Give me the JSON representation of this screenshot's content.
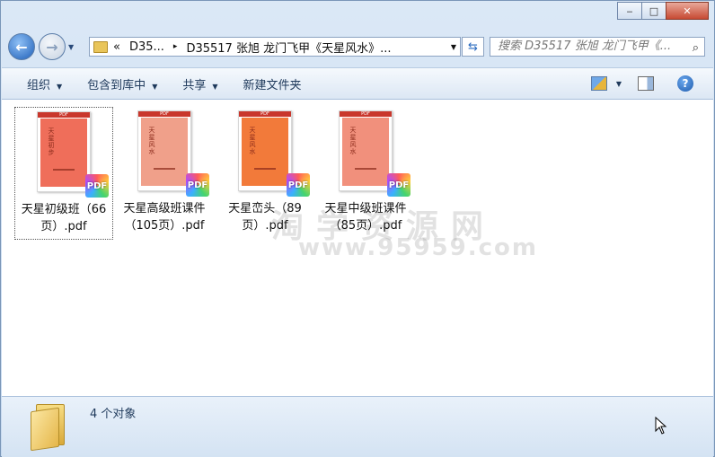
{
  "window": {
    "caption_buttons": {
      "minimize": "‒",
      "maximize": "□",
      "close": "✕"
    }
  },
  "nav": {
    "back_glyph": "←",
    "forward_glyph": "→",
    "address": {
      "overflow": "«",
      "segment1": "D35...",
      "segment2": "D35517 张旭 龙门飞甲《天星风水》...",
      "separator": "▸"
    },
    "refresh_glyph": "⇆",
    "search_placeholder": "搜索 D35517 张旭 龙门飞甲《...",
    "search_icon": "⌕"
  },
  "toolbar": {
    "organize": "组织",
    "include_library": "包含到库中",
    "share": "共享",
    "new_folder": "新建文件夹",
    "help_glyph": "?"
  },
  "files": [
    {
      "name": "天星初级班（66页）.pdf",
      "cover_title": "天星初步",
      "cover_color": "#ef6e5a",
      "selected": true
    },
    {
      "name": "天星高级班课件（105页）.pdf",
      "cover_title": "天星风水",
      "cover_color": "#f0a08a",
      "selected": false
    },
    {
      "name": "天星峦头（89页）.pdf",
      "cover_title": "天星风水",
      "cover_color": "#f27a3a",
      "selected": false
    },
    {
      "name": "天星中级班课件（85页）.pdf",
      "cover_title": "天星风水",
      "cover_color": "#f1907c",
      "selected": false
    }
  ],
  "pdf_band": "PDF",
  "pdf_badge": "PDF",
  "watermark": {
    "text": "淘学资源网",
    "url": "www.95959.com"
  },
  "status": {
    "count": "4 个对象"
  }
}
